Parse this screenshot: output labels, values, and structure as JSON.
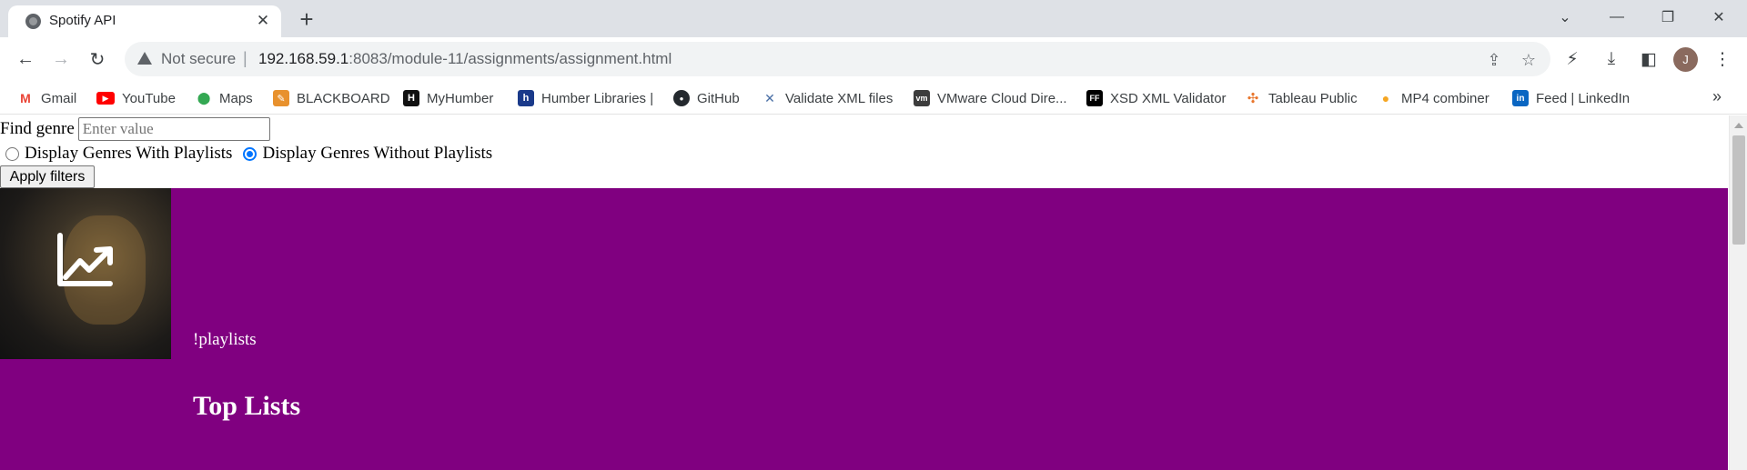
{
  "browser": {
    "tab_title": "Spotify API",
    "tab_close": "✕",
    "new_tab": "+",
    "window_controls": {
      "dropdown": "⌄",
      "minimize": "—",
      "restore": "❐",
      "close": "✕"
    },
    "nav": {
      "back": "←",
      "forward": "→",
      "reload": "↻"
    },
    "security_label": "Not secure",
    "separator": "|",
    "url_host": "192.168.59.1",
    "url_rest": ":8083/module-11/assignments/assignment.html",
    "omnibox_icons": [
      "share-icon",
      "star-icon"
    ],
    "toolbar_icons": [
      "performance-icon",
      "download-icon",
      "sidepanel-icon",
      "menu-icon"
    ],
    "profile_initial": "J"
  },
  "bookmarks": {
    "items": [
      {
        "label": "Gmail",
        "icon": "gmail-icon",
        "glyph": "M",
        "color": "#ea4335"
      },
      {
        "label": "YouTube",
        "icon": "youtube-icon",
        "glyph": "▶",
        "color": "#ff0000"
      },
      {
        "label": "Maps",
        "icon": "maps-icon",
        "glyph": "⬤",
        "color": "#34a853"
      },
      {
        "label": "BLACKBOARD",
        "icon": "blackboard-icon",
        "glyph": "✎",
        "color": "#e8912d"
      },
      {
        "label": "MyHumber",
        "icon": "myhumber-icon",
        "glyph": "H",
        "color": "#111111"
      },
      {
        "label": "Humber Libraries |",
        "icon": "humber-libraries-icon",
        "glyph": "h",
        "color": "#1a3a8a"
      },
      {
        "label": "GitHub",
        "icon": "github-icon",
        "glyph": "●",
        "color": "#24292e"
      },
      {
        "label": "Validate XML files",
        "icon": "validate-xml-icon",
        "glyph": "✕",
        "color": "#4a6fa5"
      },
      {
        "label": "VMware Cloud Dire...",
        "icon": "vmware-icon",
        "glyph": "vm",
        "color": "#3c3c3c"
      },
      {
        "label": "XSD XML Validator",
        "icon": "xsd-validator-icon",
        "glyph": "FF",
        "color": "#000000"
      },
      {
        "label": "Tableau Public",
        "icon": "tableau-icon",
        "glyph": "✣",
        "color": "#e8762d"
      },
      {
        "label": "MP4 combiner",
        "icon": "mp4-combiner-icon",
        "glyph": "●",
        "color": "#f5a623"
      },
      {
        "label": "Feed | LinkedIn",
        "icon": "linkedin-icon",
        "glyph": "in",
        "color": "#0a66c2"
      }
    ],
    "more": "»"
  },
  "filters": {
    "find_label": "Find genre",
    "search_placeholder": "Enter value",
    "option_with": "Display Genres With Playlists",
    "option_without": "Display Genres Without Playlists",
    "selected": "without",
    "apply_label": "Apply filters"
  },
  "genre": {
    "subtitle": "!playlists",
    "title": "Top Lists",
    "icon": "trending-up-icon",
    "background_color": "#800080"
  }
}
